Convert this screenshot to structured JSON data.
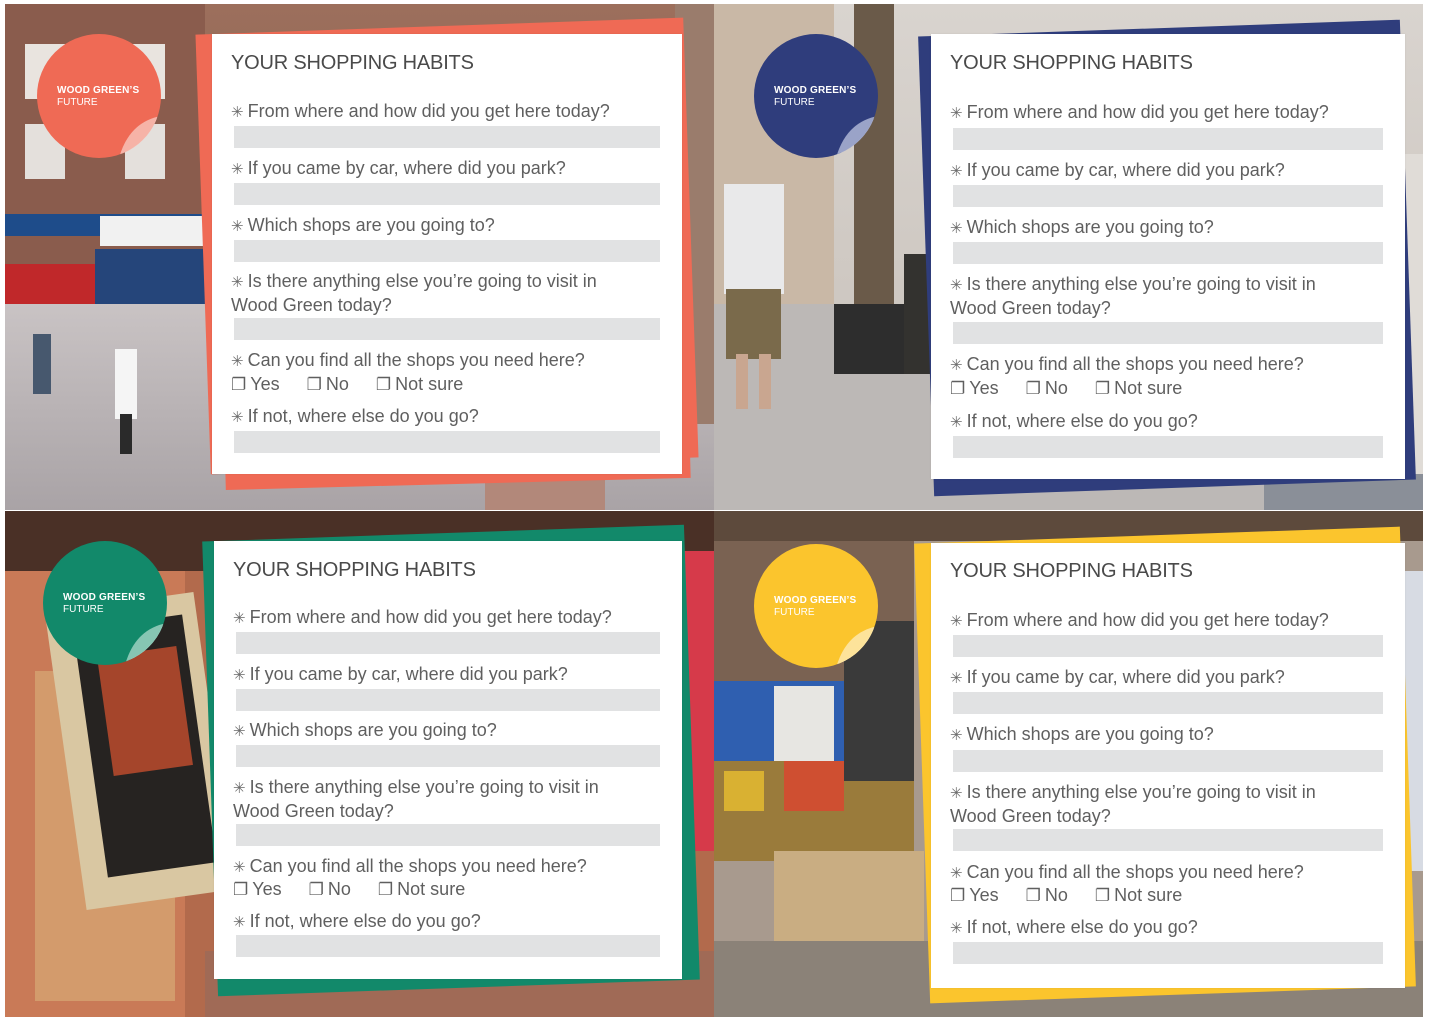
{
  "badge": {
    "line1": "WOOD GREEN’S",
    "line2": "FUTURE"
  },
  "form": {
    "title": "YOUR SHOPPING HABITS",
    "q1": "From where and how did you get here today?",
    "q2": "If you came by car, where did you park?",
    "q3": "Which shops are you going to?",
    "q4_line1": "Is there anything else you’re going to visit in",
    "q4_line2": "Wood Green today?",
    "q5": "Can you find all the shops you need here?",
    "opt_yes": "Yes",
    "opt_no": "No",
    "opt_notsure": "Not sure",
    "q6": "If not, where else do you go?"
  },
  "icons": {
    "bullet": "asterisk-bullet-icon",
    "checkbox": "checkbox-icon",
    "star_glyph": "✳",
    "box_glyph": "❐"
  },
  "colors": {
    "coral": "#ef6a55",
    "navy": "#2f3d7c",
    "green": "#12896a",
    "yellow": "#fbc52d",
    "field_gray": "#e1e2e3",
    "text_gray": "#5f5f5f"
  }
}
